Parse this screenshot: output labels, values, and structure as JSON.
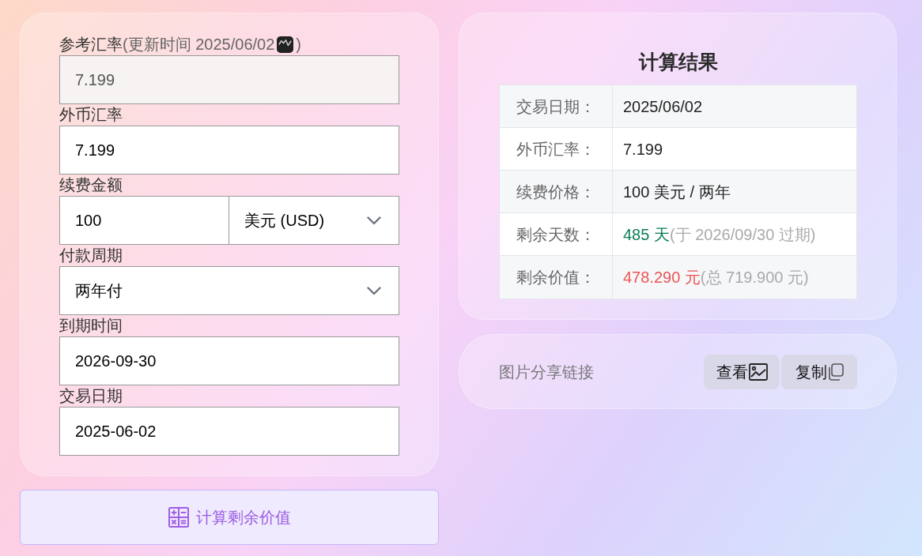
{
  "form": {
    "fields": [
      {
        "kind": "text",
        "label": "参考汇率",
        "note": "(更新时间 2025/06/02",
        "note_close": ")",
        "value": "7.199",
        "disabled": true
      },
      {
        "kind": "text",
        "label": "外币汇率",
        "value": "7.199",
        "disabled": false
      },
      {
        "kind": "amount",
        "label": "续费金额",
        "value": "100",
        "currency": "美元 (USD)",
        "disabled": false
      },
      {
        "kind": "select",
        "label": "付款周期",
        "value": "两年付",
        "disabled": false
      },
      {
        "kind": "text",
        "label": "到期时间",
        "value": "2026-09-30",
        "disabled": false
      },
      {
        "kind": "text",
        "label": "交易日期",
        "value": "2025-06-02",
        "disabled": false
      }
    ]
  },
  "calculate_button": {
    "label": "计算剩余价值"
  },
  "results": {
    "title": "计算结果",
    "rows": [
      {
        "label": "交易日期：",
        "value": "2025/06/02",
        "color": "#222222"
      },
      {
        "label": "外币汇率：",
        "value": "7.199",
        "color": "#222222"
      },
      {
        "label": "续费价格：",
        "value": "100 美元 / 两年",
        "color": "#222222"
      },
      {
        "label": "剩余天数：",
        "value": "485 天",
        "note": "(于 2026/09/30 过期)",
        "color": "#0a7d58"
      },
      {
        "label": "剩余价值：",
        "value": "478.290 元",
        "note": "(总 719.900 元)",
        "color": "#ec5454"
      }
    ]
  },
  "share": {
    "label": "图片分享链接",
    "buttons": [
      {
        "kind": "view",
        "label": "查看"
      },
      {
        "kind": "copy",
        "label": "复制"
      }
    ]
  }
}
